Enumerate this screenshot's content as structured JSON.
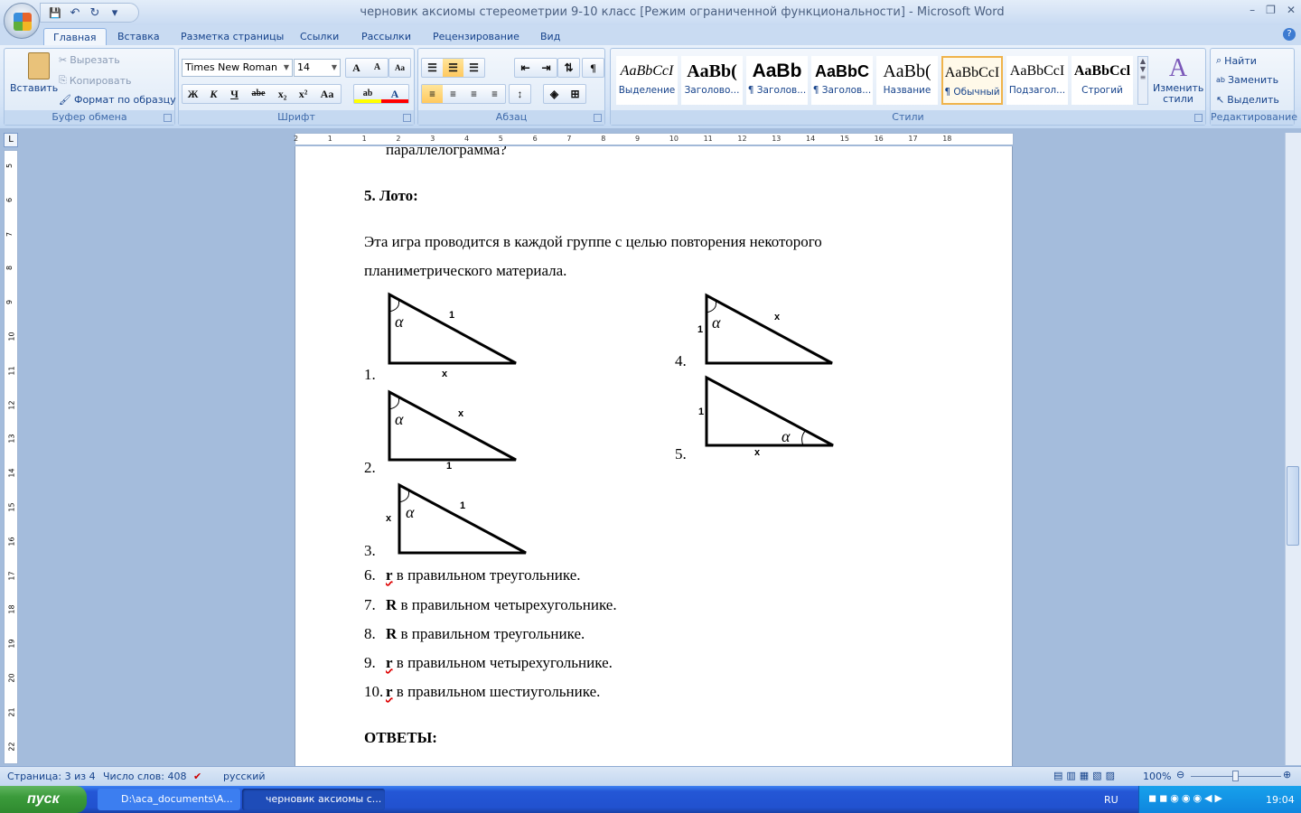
{
  "window": {
    "title": "черновик аксиомы стереометрии 9-10 класс [Режим ограниченной функциональности] - Microsoft Word",
    "minimize": "–",
    "restore": "❐",
    "close": "✕"
  },
  "qat": {
    "save": "💾",
    "undo": "↶",
    "redo": "↻",
    "customize": "▾"
  },
  "tabs": [
    "Главная",
    "Вставка",
    "Разметка страницы",
    "Ссылки",
    "Рассылки",
    "Рецензирование",
    "Вид"
  ],
  "clipboard": {
    "paste": "Вставить",
    "cut": "Вырезать",
    "copy": "Копировать",
    "format_painter": "Формат по образцу",
    "label": "Буфер обмена"
  },
  "font": {
    "name": "Times New Roman",
    "size": "14",
    "grow": "A",
    "shrink": "A",
    "clear": "Aa",
    "bold": "Ж",
    "italic": "К",
    "underline": "Ч",
    "strike": "abe",
    "subscript": "x₂",
    "superscript": "x²",
    "case": "Aa",
    "highlight": "ab",
    "color": "A",
    "label": "Шрифт",
    "highlight_color": "#ffff00",
    "font_color": "#ff0000"
  },
  "paragraph": {
    "label": "Абзац",
    "pilcrow": "¶"
  },
  "styles": {
    "items": [
      {
        "preview": "AaBbCcI",
        "name": "Выделение"
      },
      {
        "preview": "AaBb(",
        "name": "Заголово..."
      },
      {
        "preview": "AaBb",
        "name": "¶ Заголов..."
      },
      {
        "preview": "AaBbC",
        "name": "¶ Заголов..."
      },
      {
        "preview": "AaBb(",
        "name": "Название"
      },
      {
        "preview": "AaBbCcI",
        "name": "¶ Обычный",
        "selected": true
      },
      {
        "preview": "AaBbCcI",
        "name": "Подзагол..."
      },
      {
        "preview": "AaBbCcl",
        "name": "Строгий"
      }
    ],
    "change": "Изменить стили",
    "label": "Стили"
  },
  "editing": {
    "find": "Найти",
    "replace": "Заменить",
    "select": "Выделить",
    "label": "Редактирование"
  },
  "ruler": {
    "ticks": [
      "2",
      "1",
      "1",
      "2",
      "3",
      "4",
      "5",
      "6",
      "7",
      "8",
      "9",
      "10",
      "11",
      "12",
      "13",
      "14",
      "15",
      "16",
      "17",
      "18"
    ],
    "vticks": [
      "5",
      "6",
      "7",
      "8",
      "9",
      "10",
      "11",
      "12",
      "13",
      "14",
      "15",
      "16",
      "17",
      "18",
      "19",
      "20",
      "21",
      "22"
    ]
  },
  "document": {
    "prev_line": "параллелограмма?",
    "heading": "5. Лото:",
    "intro_1": "Эта игра проводится в каждой группе с целью повторения некоторого",
    "intro_2": "планиметрического материала.",
    "angle": "α",
    "figures": [
      {
        "num": "1.",
        "hyp": "1",
        "leg_bottom": "x"
      },
      {
        "num": "2.",
        "hyp": "x",
        "leg_bottom": "1"
      },
      {
        "num": "3.",
        "hyp": "1",
        "leg_left": "x"
      },
      {
        "num": "4.",
        "hyp": "x",
        "leg_left": "1"
      },
      {
        "num": "5.",
        "leg_left": "1",
        "leg_bottom": "x"
      }
    ],
    "items": [
      {
        "num": "6.",
        "var": "r",
        "text": " в правильном треугольнике."
      },
      {
        "num": "7.",
        "var": "R",
        "text": " в правильном четырехугольнике."
      },
      {
        "num": "8.",
        "var": "R",
        "text": " в правильном треугольнике."
      },
      {
        "num": "9.",
        "var": "r",
        "text": " в правильном четырехугольнике."
      },
      {
        "num": "10.",
        "var": "r",
        "text": " в правильном шестиугольнике."
      }
    ],
    "answers": "ОТВЕТЫ:"
  },
  "status": {
    "page": "Страница: 3 из 4",
    "words": "Число слов: 408",
    "lang": "русский",
    "zoom": "100%",
    "zoom_level": 100
  },
  "taskbar": {
    "start": "пуск",
    "tasks": [
      "D:\\аса_documents\\A...",
      "черновик аксиомы с..."
    ],
    "lang": "RU",
    "clock": "19:04"
  }
}
